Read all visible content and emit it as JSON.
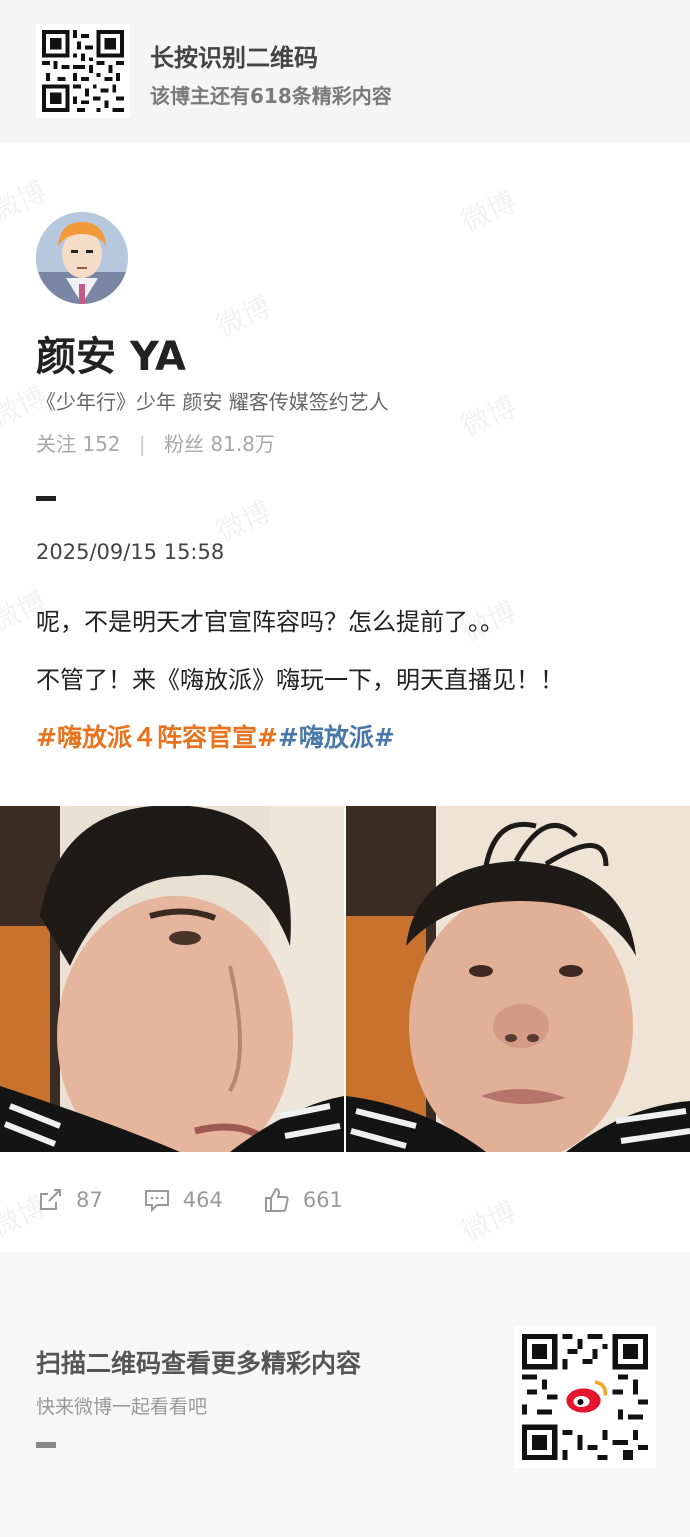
{
  "header": {
    "title": "长按识别二维码",
    "subtitle": "该博主还有618条精彩内容"
  },
  "profile": {
    "name": "颜安 YA",
    "bio": "《少年行》少年 颜安 耀客传媒签约艺人",
    "following_label": "关注",
    "following": "152",
    "followers_label": "粉丝",
    "followers": "81.8万"
  },
  "post": {
    "date": "2025/09/15 15:58",
    "line1": "呢，不是明天才官宣阵容吗？怎么提前了。。",
    "line2": "不管了！来《嗨放派》嗨玩一下，明天直播见！！",
    "tag1": "#嗨放派４阵容官宣#",
    "tag2": "#嗨放派#"
  },
  "actions": {
    "reposts": "87",
    "comments": "464",
    "likes": "661"
  },
  "footer": {
    "title": "扫描二维码查看更多精彩内容",
    "subtitle": "快来微博一起看看吧"
  },
  "watermark": "微博",
  "colors": {
    "tag_orange": "#e8731e",
    "tag_blue": "#4a78a8",
    "weibo_red": "#e6162d"
  }
}
